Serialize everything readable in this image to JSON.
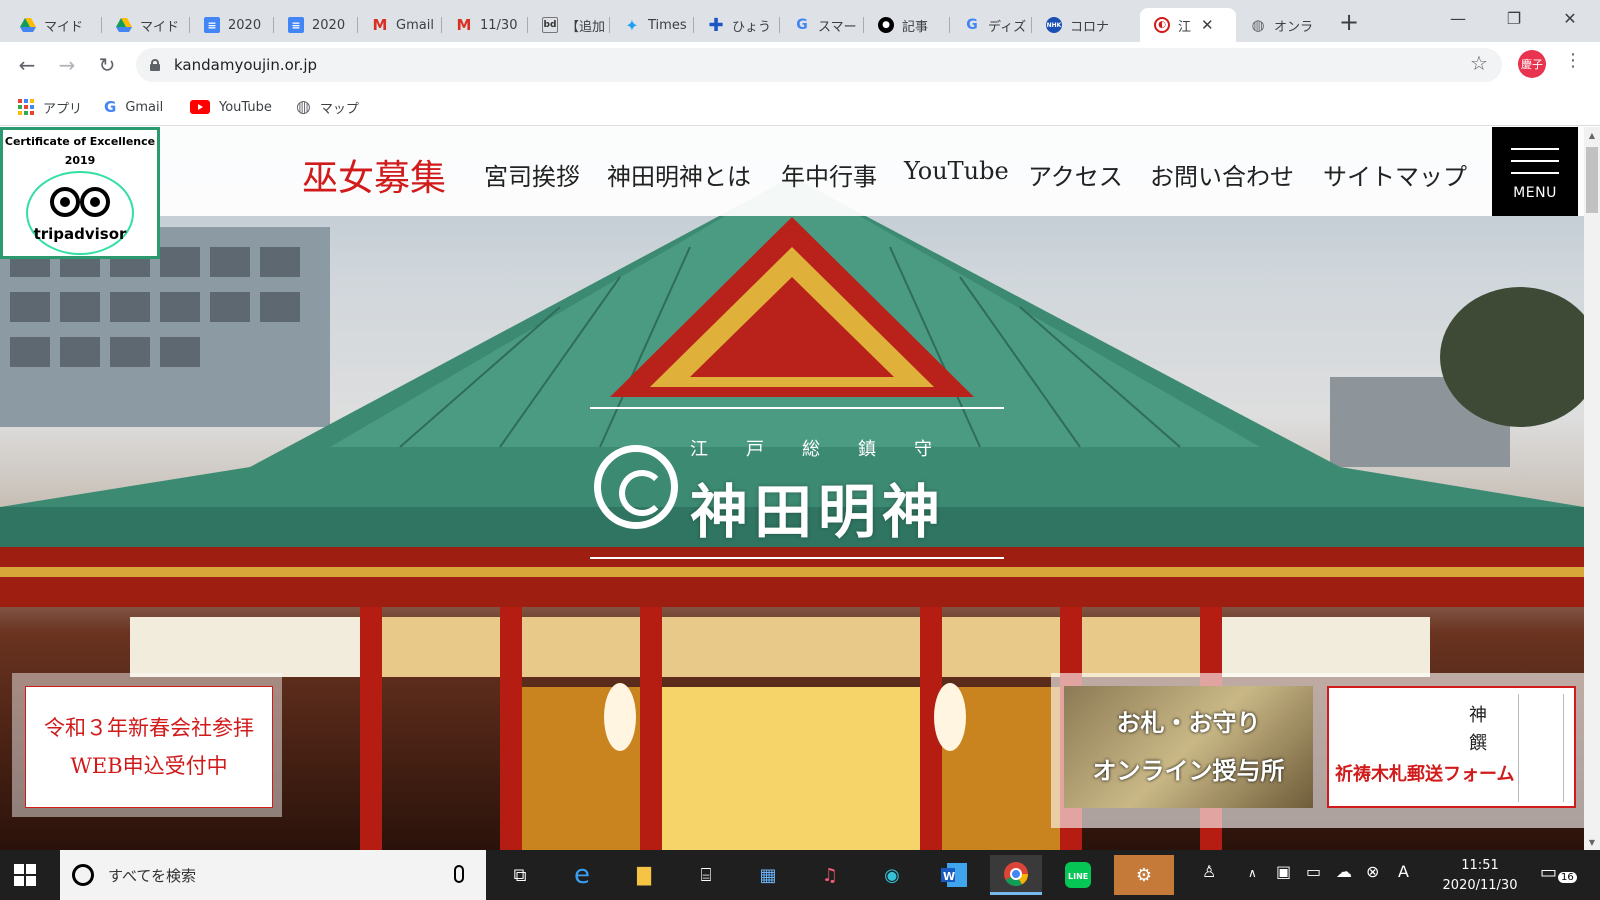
{
  "browser": {
    "tabs": [
      {
        "label": "マイド",
        "icon": "google-drive-icon"
      },
      {
        "label": "マイド",
        "icon": "google-drive-icon"
      },
      {
        "label": "2020",
        "icon": "google-docs-icon"
      },
      {
        "label": "2020",
        "icon": "google-docs-icon"
      },
      {
        "label": "Gmail",
        "icon": "gmail-icon"
      },
      {
        "label": "11/30",
        "icon": "gmail-icon"
      },
      {
        "label": "【追加",
        "icon": "bd-icon"
      },
      {
        "label": "Times",
        "icon": "twitter-icon"
      },
      {
        "label": "ひょう",
        "icon": "plus-cross-icon"
      },
      {
        "label": "スマー",
        "icon": "google-icon"
      },
      {
        "label": "記事",
        "icon": "site-icon"
      },
      {
        "label": "ディズ",
        "icon": "google-icon"
      },
      {
        "label": "コロナ",
        "icon": "nhk-icon"
      },
      {
        "label": "江",
        "icon": "kandamyoujin-icon",
        "active": true
      },
      {
        "label": "オンラ",
        "icon": "globe-icon"
      }
    ],
    "new_tab": "+",
    "address": "kandamyoujin.or.jp",
    "profile_initials": "慶子",
    "bookmarks": [
      {
        "label": "アプリ",
        "icon": "apps-grid-icon"
      },
      {
        "label": "Gmail",
        "icon": "google-icon"
      },
      {
        "label": "YouTube",
        "icon": "youtube-icon"
      },
      {
        "label": "マップ",
        "icon": "globe-icon"
      }
    ]
  },
  "site": {
    "certificate": {
      "title": "Certificate of Excellence",
      "year": "2019",
      "brand": "tripadvisor"
    },
    "nav": {
      "recruit": "巫女募集",
      "items": [
        "宮司挨拶",
        "神田明神とは",
        "年中行事",
        "YouTube",
        "アクセス",
        "お問い合わせ",
        "サイトマップ"
      ]
    },
    "menu_label": "MENU",
    "logo": {
      "sub": "江戸総鎮守",
      "main": "神田明神"
    },
    "banners": {
      "left": {
        "line1": "令和３年新春会社参拝",
        "line2": "WEB申込受付中"
      },
      "amulet": {
        "line1": "お札・お守り",
        "line2": "オンライン授与所"
      },
      "mail": {
        "text": "祈祷木札郵送フォーム",
        "kanji": "神饌"
      }
    }
  },
  "taskbar": {
    "search_placeholder": "すべてを検索",
    "time": "11:51",
    "date": "2020/11/30",
    "notification_count": "16"
  },
  "colors": {
    "accent_red": "#d11b1b",
    "tripadvisor_green": "#34e0a1",
    "menu_black": "#000000"
  }
}
